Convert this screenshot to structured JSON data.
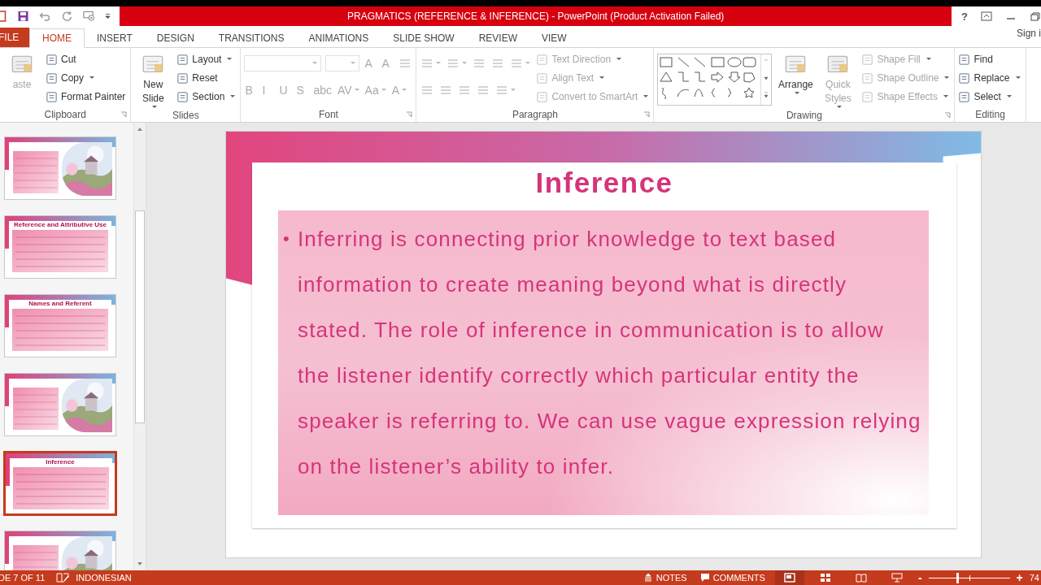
{
  "window": {
    "title": "PRAGMATICS (REFERENCE & INFERENCE) -  PowerPoint (Product Activation Failed)",
    "help": "?",
    "sign_in": "Sign i"
  },
  "tabs": [
    {
      "label": "FILE",
      "kind": "file",
      "selected": false
    },
    {
      "label": "HOME",
      "kind": "tab",
      "selected": true
    },
    {
      "label": "INSERT",
      "kind": "tab",
      "selected": false
    },
    {
      "label": "DESIGN",
      "kind": "tab",
      "selected": false
    },
    {
      "label": "TRANSITIONS",
      "kind": "tab",
      "selected": false
    },
    {
      "label": "ANIMATIONS",
      "kind": "tab",
      "selected": false
    },
    {
      "label": "SLIDE SHOW",
      "kind": "tab",
      "selected": false
    },
    {
      "label": "REVIEW",
      "kind": "tab",
      "selected": false
    },
    {
      "label": "VIEW",
      "kind": "tab",
      "selected": false
    }
  ],
  "ribbon": [
    {
      "label": "Clipboard",
      "launcher": true,
      "columns": [
        [
          {
            "kind": "large",
            "label": "aste",
            "disabled": true,
            "dropdown": false
          }
        ],
        [
          {
            "kind": "small",
            "label": "Cut",
            "disabled": false,
            "dropdown": false
          },
          {
            "kind": "small",
            "label": "Copy",
            "disabled": false,
            "dropdown": true
          },
          {
            "kind": "small",
            "label": "Format Painter",
            "disabled": false,
            "dropdown": false
          }
        ]
      ]
    },
    {
      "label": "Slides",
      "launcher": false,
      "columns": [
        [
          {
            "kind": "large",
            "label": "New Slide",
            "disabled": false,
            "dropdown": true
          }
        ],
        [
          {
            "kind": "small",
            "label": "Layout",
            "disabled": false,
            "dropdown": true
          },
          {
            "kind": "small",
            "label": "Reset",
            "disabled": false,
            "dropdown": false
          },
          {
            "kind": "small",
            "label": "Section",
            "disabled": false,
            "dropdown": true
          }
        ]
      ]
    },
    {
      "label": "Font",
      "launcher": true,
      "columns": [
        [
          {
            "kind": "row",
            "items": [
              {
                "kind": "combo",
                "wide": true,
                "disabled": true
              },
              {
                "kind": "combo",
                "wide": false,
                "disabled": true
              },
              {
                "kind": "glyph",
                "label": "A",
                "disabled": true,
                "dropdown": false
              },
              {
                "kind": "glyph",
                "label": "A",
                "disabled": true,
                "dropdown": false
              },
              {
                "kind": "icon",
                "disabled": true,
                "dropdown": false
              }
            ]
          },
          {
            "kind": "row",
            "items": [
              {
                "kind": "glyph",
                "label": "B",
                "disabled": true,
                "dropdown": false
              },
              {
                "kind": "glyph",
                "label": "I",
                "disabled": true,
                "dropdown": false
              },
              {
                "kind": "glyph",
                "label": "U",
                "disabled": true,
                "dropdown": false
              },
              {
                "kind": "glyph",
                "label": "S",
                "disabled": true,
                "dropdown": false
              },
              {
                "kind": "glyph",
                "label": "abc",
                "disabled": true,
                "dropdown": false
              },
              {
                "kind": "glyph",
                "label": "AV",
                "disabled": true,
                "dropdown": true
              },
              {
                "kind": "glyph",
                "label": "Aa",
                "disabled": true,
                "dropdown": true
              },
              {
                "kind": "glyph",
                "label": "A",
                "disabled": true,
                "dropdown": true
              }
            ]
          }
        ]
      ]
    },
    {
      "label": "Paragraph",
      "launcher": true,
      "columns": [
        [
          {
            "kind": "row",
            "items": [
              {
                "kind": "icon",
                "disabled": true,
                "dropdown": true
              },
              {
                "kind": "icon",
                "disabled": true,
                "dropdown": true
              },
              {
                "kind": "icon",
                "disabled": true,
                "dropdown": false
              },
              {
                "kind": "icon",
                "disabled": true,
                "dropdown": false
              },
              {
                "kind": "icon",
                "disabled": true,
                "dropdown": true
              }
            ]
          },
          {
            "kind": "row",
            "items": [
              {
                "kind": "icon",
                "disabled": true,
                "dropdown": false
              },
              {
                "kind": "icon",
                "disabled": true,
                "dropdown": false
              },
              {
                "kind": "icon",
                "disabled": true,
                "dropdown": false
              },
              {
                "kind": "icon",
                "disabled": true,
                "dropdown": false
              },
              {
                "kind": "icon",
                "disabled": true,
                "dropdown": true
              }
            ]
          }
        ],
        [
          {
            "kind": "small",
            "label": "Text Direction",
            "disabled": true,
            "dropdown": true
          },
          {
            "kind": "small",
            "label": "Align Text",
            "disabled": true,
            "dropdown": true
          },
          {
            "kind": "small",
            "label": "Convert to SmartArt",
            "disabled": true,
            "dropdown": true
          }
        ]
      ]
    },
    {
      "label": "Drawing",
      "launcher": true,
      "columns": [
        [
          {
            "kind": "gallery"
          }
        ],
        [
          {
            "kind": "large",
            "label": "Arrange",
            "disabled": false,
            "dropdown": true
          }
        ],
        [
          {
            "kind": "large",
            "label": "Quick Styles",
            "disabled": true,
            "dropdown": true
          }
        ],
        [
          {
            "kind": "small",
            "label": "Shape Fill",
            "disabled": true,
            "dropdown": true
          },
          {
            "kind": "small",
            "label": "Shape Outline",
            "disabled": true,
            "dropdown": true
          },
          {
            "kind": "small",
            "label": "Shape Effects",
            "disabled": true,
            "dropdown": true
          }
        ]
      ]
    },
    {
      "label": "Editing",
      "launcher": false,
      "columns": [
        [
          {
            "kind": "small",
            "label": "Find",
            "disabled": false,
            "dropdown": false
          },
          {
            "kind": "small",
            "label": "Replace",
            "disabled": false,
            "dropdown": true
          },
          {
            "kind": "small",
            "label": "Select",
            "disabled": false,
            "dropdown": true
          }
        ]
      ]
    }
  ],
  "thumbnails": [
    {
      "picture": true,
      "selected": false
    },
    {
      "title": "Reference and Attributive Use",
      "picture": false,
      "selected": false
    },
    {
      "title": "Names and Referent",
      "picture": false,
      "selected": false
    },
    {
      "picture": true,
      "selected": false
    },
    {
      "title": "Inference",
      "picture": false,
      "selected": true
    },
    {
      "picture": true,
      "selected": false
    }
  ],
  "slide": {
    "title": "Inference",
    "bullet": "•",
    "body": "Inferring is connecting prior knowledge to text based information to create meaning beyond what is directly stated. The role of inference in communication is to allow the listener identify correctly which particular entity the speaker is referring to. We can use vague expression relying on the listener’s ability to infer."
  },
  "status_bar": {
    "slide": "DE 7 OF 11",
    "language": "INDONESIAN",
    "notes": "NOTES",
    "comments": "COMMENTS",
    "views": [
      {
        "selected": true
      },
      {
        "selected": false
      },
      {
        "selected": false
      },
      {
        "selected": false
      }
    ],
    "zoom_minus": "-",
    "zoom_plus": "+",
    "zoom": {
      "level": 0.34
    },
    "zoom_percent": "74"
  }
}
